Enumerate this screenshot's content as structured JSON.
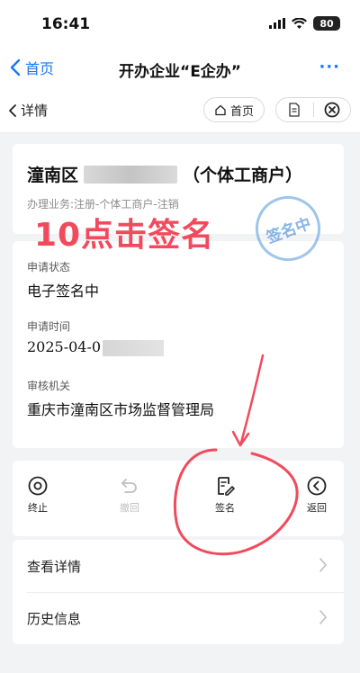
{
  "status_bar": {
    "time": "16:41",
    "battery": "80"
  },
  "nav": {
    "back_label": "首页",
    "title": "开办企业“E企办”",
    "more_label": "···"
  },
  "sub_header": {
    "back_label": "详情",
    "home_label": "首页"
  },
  "company": {
    "name_prefix": "潼南区",
    "name_suffix": "（个体工商户）",
    "business": "办理业务:注册-个体工商户-注销"
  },
  "stamp_text": "签名中",
  "overlay_instruction": "10点击签名",
  "info": [
    {
      "label": "申请状态",
      "value": "电子签名中"
    },
    {
      "label": "申请时间",
      "value": "2025-04-0"
    },
    {
      "label": "审核机关",
      "value": "重庆市潼南区市场监督管理局"
    }
  ],
  "actions": [
    {
      "label": "终止",
      "icon": "stop-circle-icon",
      "enabled": true
    },
    {
      "label": "撤回",
      "icon": "undo-icon",
      "enabled": false
    },
    {
      "label": "签名",
      "icon": "sign-document-icon",
      "enabled": true
    },
    {
      "label": "返回",
      "icon": "back-circle-icon",
      "enabled": true
    }
  ],
  "menu": [
    {
      "label": "查看详情"
    },
    {
      "label": "历史信息"
    }
  ],
  "colors": {
    "accent": "#1677ff",
    "annotation": "#f24a5c",
    "stamp": "#5096dc"
  }
}
